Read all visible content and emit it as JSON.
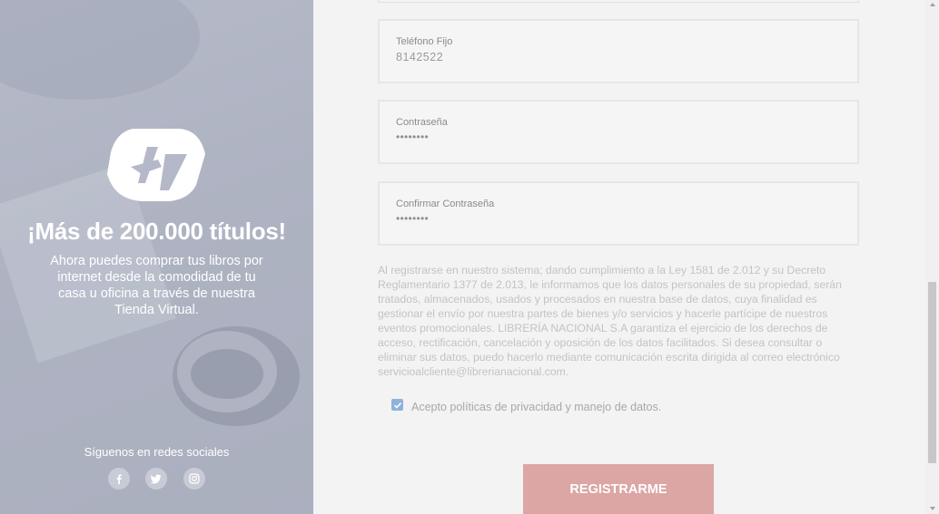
{
  "promo": {
    "headline": "¡Más de 200.000 títulos!",
    "subtext": "Ahora puedes comprar tus libros por internet desde la comodidad de tu casa u oficina a través de nuestra Tienda Virtual.",
    "follow_label": "Síguenos en redes sociales",
    "social_icons": [
      "facebook-icon",
      "twitter-icon",
      "instagram-icon"
    ]
  },
  "form": {
    "fields": [
      {
        "label": "Teléfono Fijo",
        "value": "8142522"
      },
      {
        "label": "Contraseña",
        "value": "••••••••"
      },
      {
        "label": "Confirmar Contraseña",
        "value": "••••••••"
      }
    ],
    "legal_text": "Al registrarse en nuestro sistema; dando cumplimiento a la Ley 1581 de 2.012 y su Decreto Reglamentario 1377 de 2.013, le informamos que los datos personales de su propiedad, serán tratados, almacenados, usados y procesados en nuestra base de datos, cuya finalidad es gestionar el envío por nuestra partes de bienes y/o servicios y hacerle partícipe de nuestros eventos promocionales. LIBRERÍA NACIONAL S.A garantiza el ejercicio de los derechos de acceso, rectificación, cancelación y oposición de los datos facilitados. Si desea consultar o eliminar sus datos, puedo hacerlo mediante comunicación escrita dirigida al correo electrónico servicioalcliente@librerianacional.com.",
    "privacy_checkbox": {
      "label": "Acepto políticas de privacidad y manejo de datos.",
      "checked": true
    },
    "submit_label": "REGISTRARME"
  },
  "colors": {
    "button": "#dba6a4",
    "checkbox": "#8fb2dc",
    "panel": "#aeb2c2"
  }
}
